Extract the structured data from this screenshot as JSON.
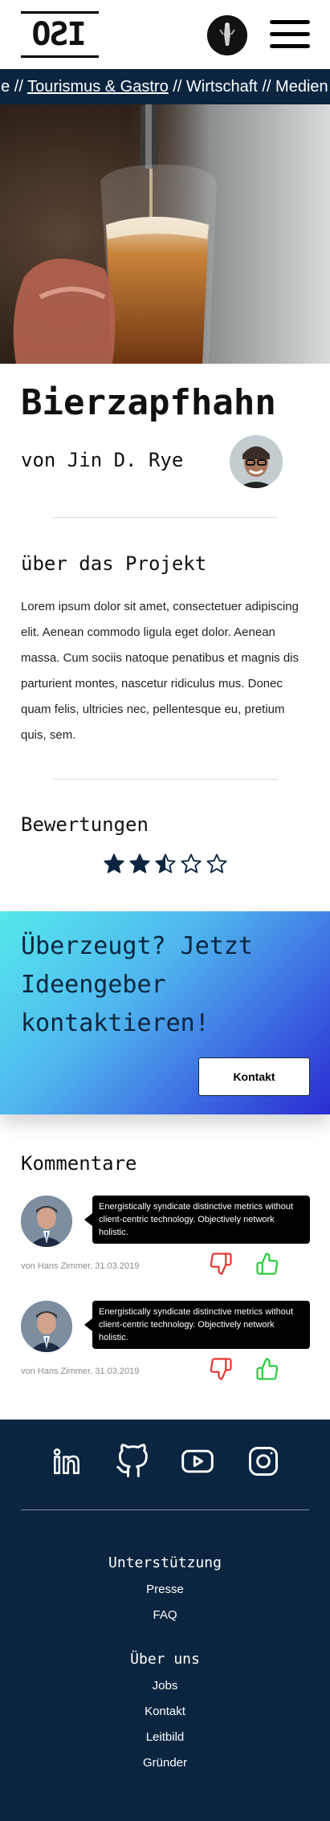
{
  "header": {
    "logo_text": "ISO"
  },
  "ticker": {
    "prefix": "rie // ",
    "active": "Tourismus & Gastro",
    "suffix": " // Wirtschaft // Medien &"
  },
  "project": {
    "title": "Bierzapfhahn",
    "author": "von Jin D. Rye",
    "about_heading": "über das Projekt",
    "description": "Lorem ipsum dolor sit amet, consectetuer adipiscing elit. Aenean commodo ligula eget dolor. Aenean massa. Cum sociis natoque penatibus et magnis dis parturient montes, nascetur ridiculus mus. Donec quam felis, ultricies nec, pellentesque eu, pretium quis, sem."
  },
  "rating": {
    "heading": "Bewertungen",
    "value": 2.5,
    "max": 5
  },
  "cta": {
    "text": "Überzeugt? Jetzt Ideengeber kontaktieren!",
    "button": "Kontakt"
  },
  "comments": {
    "heading": "Kommentare",
    "items": [
      {
        "text": "Energistically syndicate distinctive metrics without client-centric technology. Objectively network holistic.",
        "meta": "von Hans Zimmer, 31.03.2019"
      },
      {
        "text": "Energistically syndicate distinctive metrics without client-centric technology. Objectively network holistic.",
        "meta": "von Hans Zimmer, 31.03.2019"
      }
    ]
  },
  "colors": {
    "navy": "#0b2540",
    "thumb_down": "#e53935",
    "thumb_up": "#2ecc40"
  },
  "social_icons": [
    "linkedin-icon",
    "github-icon",
    "youtube-icon",
    "instagram-icon"
  ],
  "footer": {
    "support_heading": "Unterstützung",
    "support_links": [
      "Presse",
      "FAQ"
    ],
    "about_heading": "Über uns",
    "about_links": [
      "Jobs",
      "Kontakt",
      "Leitbild",
      "Gründer"
    ]
  }
}
